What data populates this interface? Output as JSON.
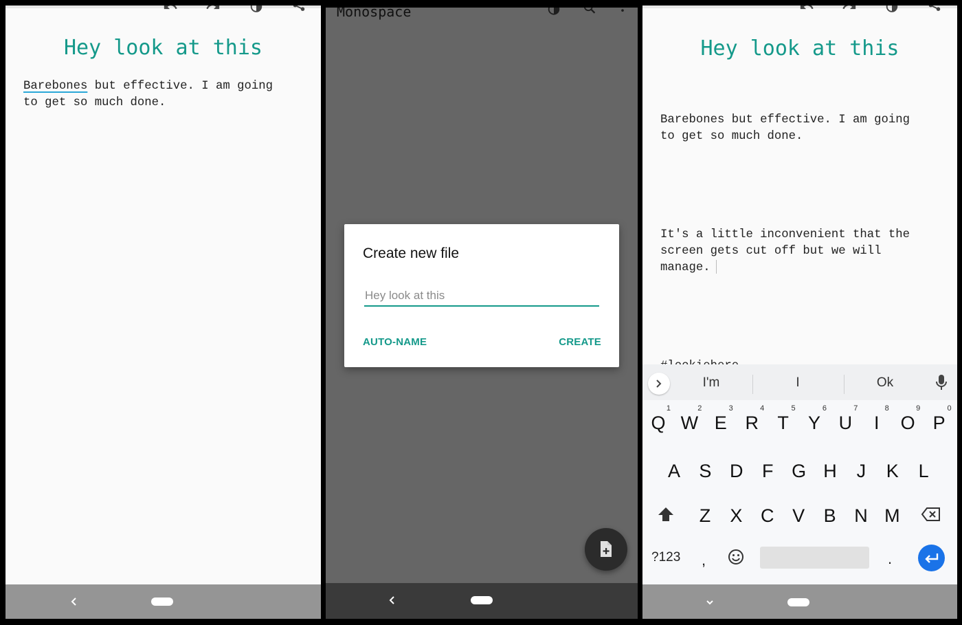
{
  "editor_left": {
    "toolbar": [
      "undo-icon",
      "redo-icon",
      "theme-contrast-icon",
      "share-icon"
    ],
    "title": "Hey look at this",
    "body_underlined_word": "Barebones",
    "body_rest": " but effective. I am going\nto get so much done.",
    "nav": {
      "back": "back-icon",
      "home": "home-pill"
    }
  },
  "file_list_dialog": {
    "app_title": "Monospace",
    "toolbar": [
      "theme-contrast-icon",
      "search-icon",
      "more-vert-icon"
    ],
    "dialog": {
      "title": "Create new file",
      "input_value": "",
      "input_placeholder": "Hey look at this",
      "auto_name_label": "AUTO-NAME",
      "create_label": "CREATE"
    },
    "fab": "new-file-icon",
    "nav": {
      "back": "back-icon",
      "home": "home-pill"
    }
  },
  "editor_right": {
    "toolbar": [
      "undo-icon",
      "redo-icon",
      "theme-contrast-icon",
      "share-icon"
    ],
    "title": "Hey look at this",
    "body_paragraph_1": "Barebones but effective. I am going\nto get so much done.",
    "body_paragraph_2": "It's a little inconvenient that the\nscreen gets cut off but we will\nmanage.",
    "body_paragraph_3": "#lookiehere",
    "keyboard": {
      "suggestions": [
        "I'm",
        "I",
        "Ok"
      ],
      "row1": [
        {
          "key": "Q",
          "alt": "1"
        },
        {
          "key": "W",
          "alt": "2"
        },
        {
          "key": "E",
          "alt": "3"
        },
        {
          "key": "R",
          "alt": "4"
        },
        {
          "key": "T",
          "alt": "5"
        },
        {
          "key": "Y",
          "alt": "6"
        },
        {
          "key": "U",
          "alt": "7"
        },
        {
          "key": "I",
          "alt": "8"
        },
        {
          "key": "O",
          "alt": "9"
        },
        {
          "key": "P",
          "alt": "0"
        }
      ],
      "row2": [
        "A",
        "S",
        "D",
        "F",
        "G",
        "H",
        "J",
        "K",
        "L"
      ],
      "row3": [
        "Z",
        "X",
        "C",
        "V",
        "B",
        "N",
        "M"
      ],
      "symbols_label": "?123",
      "comma": ",",
      "period": ".",
      "enter_color": "#1a73e8"
    },
    "nav": {
      "back": "hide-keyboard-icon",
      "home": "home-pill"
    }
  },
  "colors": {
    "accent": "#14998a",
    "scrim": "#666666",
    "navbar_light": "#959595",
    "navbar_dark": "#3a3a3a"
  }
}
